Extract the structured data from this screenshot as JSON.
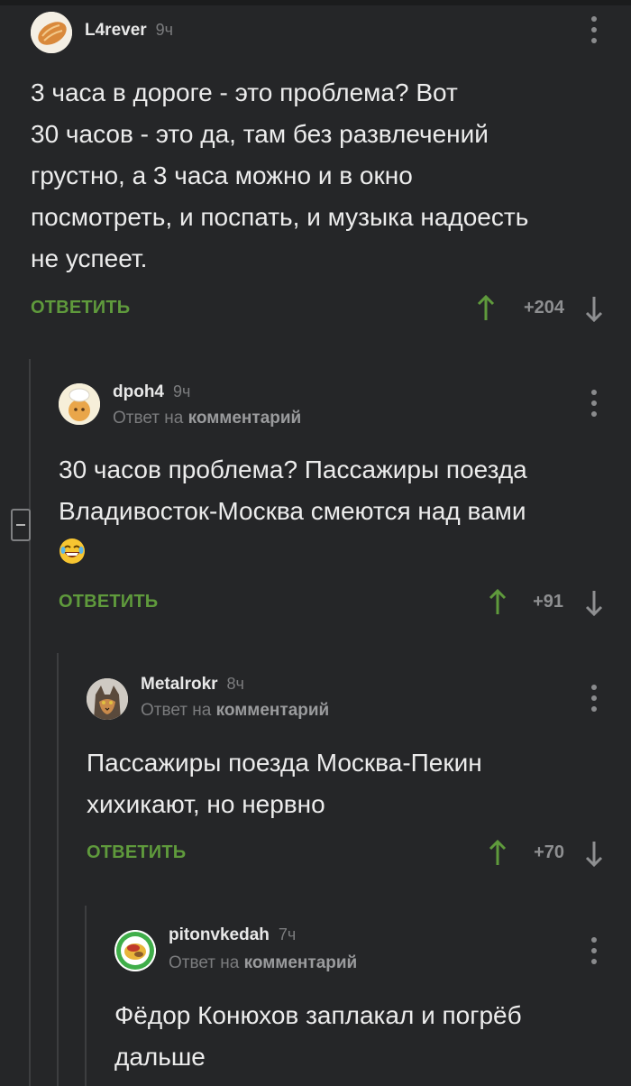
{
  "ui": {
    "colors": {
      "background": "#252628",
      "accent_green": "#5f9a3c",
      "muted": "#7b7c7e",
      "text": "#ececec"
    },
    "reply_to_prefix": "Ответ на",
    "reply_to_target": "комментарий",
    "reply_label": "ОТВЕТИТЬ"
  },
  "comments": [
    {
      "username": "L4rever",
      "time": "9ч",
      "avatar_icon": "bread-avatar-icon",
      "lines": [
        "3 часа в дороге - это проблема? Вот",
        "30 часов - это да, там без развлечений",
        "грустно, а 3 часа можно и в окно",
        "посмотреть, и поспать, и музыка надоесть",
        "не успеет."
      ],
      "score": "+204"
    },
    {
      "username": "dpoh4",
      "time": "9ч",
      "avatar_icon": "cook-avatar-icon",
      "lines": [
        "30 часов проблема? Пассажиры поезда",
        "Владивосток-Москва смеются над вами"
      ],
      "emoji": "laughing-emoji",
      "score": "+91"
    },
    {
      "username": "Metalrokr",
      "time": "8ч",
      "avatar_icon": "cat-avatar-icon",
      "lines": [
        "Пассажиры поезда Москва-Пекин",
        "хихикают, но нервно"
      ],
      "score": "+70"
    },
    {
      "username": "pitonvkedah",
      "time": "7ч",
      "avatar_icon": "food-avatar-icon",
      "lines": [
        "Фёдор Конюхов заплакал и погрёб",
        "дальше"
      ]
    }
  ]
}
